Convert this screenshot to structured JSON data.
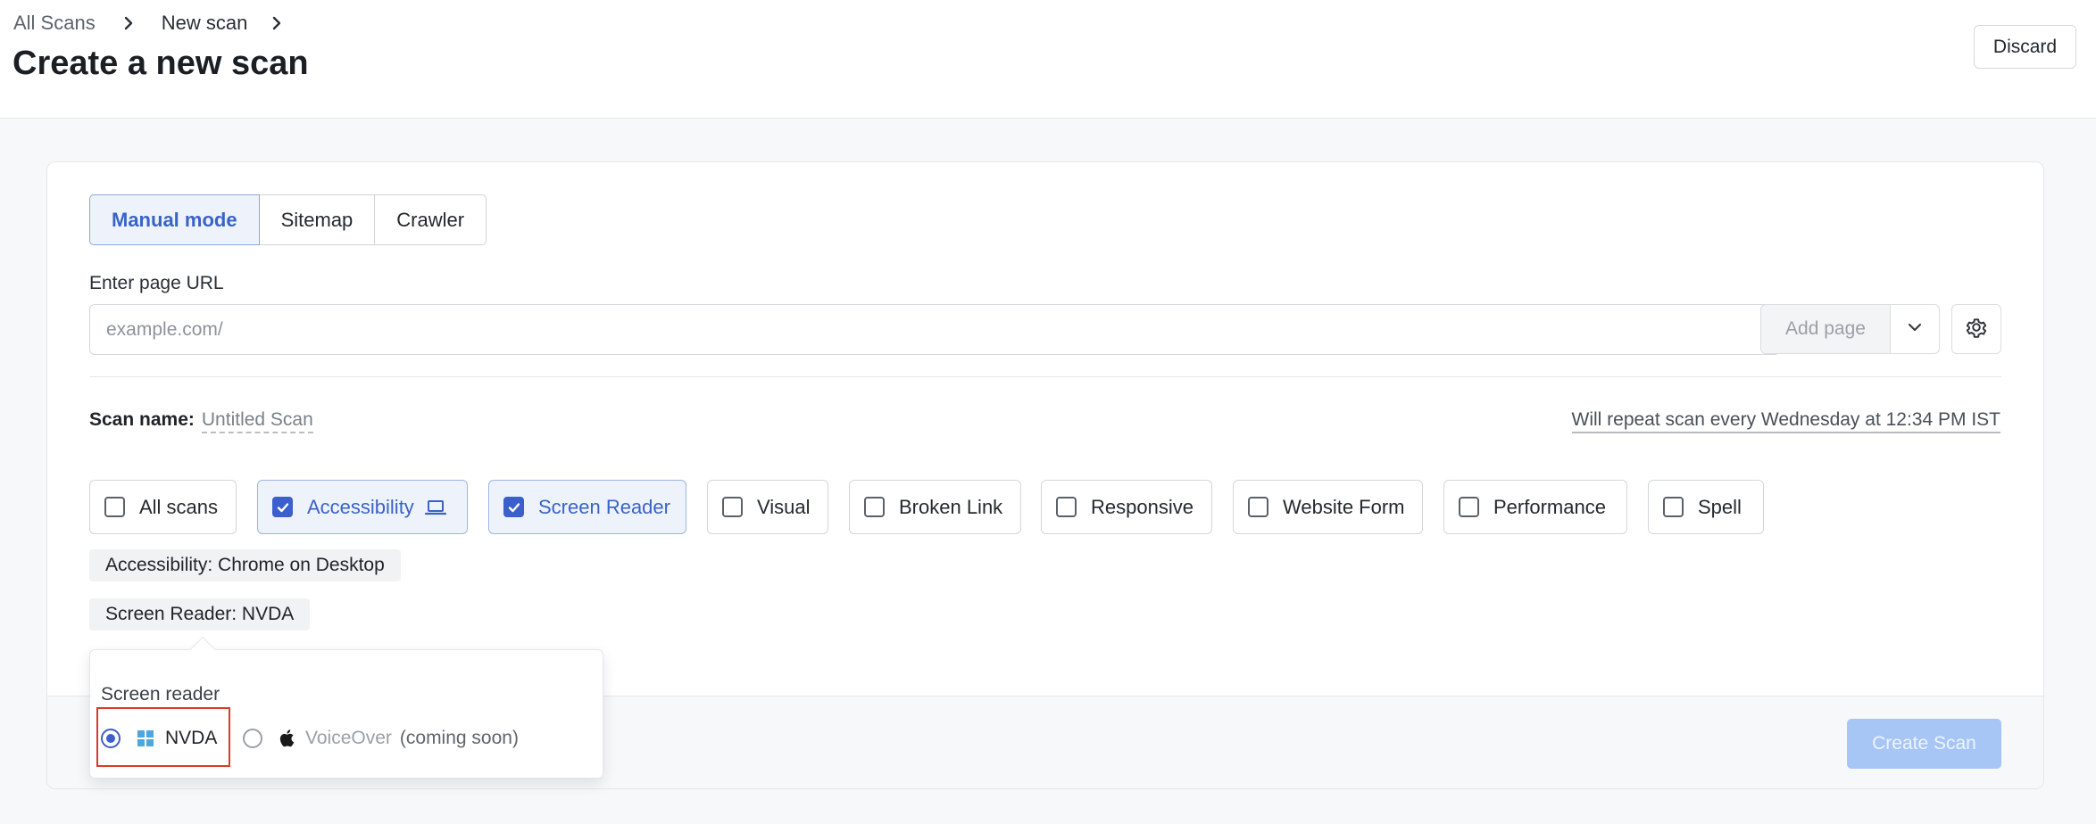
{
  "breadcrumb": {
    "root": "All Scans",
    "current": "New scan"
  },
  "page_title": "Create a new scan",
  "header": {
    "discard_label": "Discard"
  },
  "modes": {
    "tabs": [
      "Manual mode",
      "Sitemap",
      "Crawler"
    ],
    "active": "Manual mode"
  },
  "url_entry": {
    "label": "Enter page URL",
    "placeholder": "example.com/",
    "add_page_label": "Add page"
  },
  "scan_name": {
    "label": "Scan name:",
    "value": "Untitled Scan"
  },
  "schedule": {
    "text": "Will repeat scan every Wednesday at 12:34 PM IST"
  },
  "scan_types": [
    {
      "label": "All scans",
      "checked": false
    },
    {
      "label": "Accessibility",
      "checked": true,
      "icon": "laptop-icon"
    },
    {
      "label": "Screen Reader",
      "checked": true
    },
    {
      "label": "Visual",
      "checked": false
    },
    {
      "label": "Broken Link",
      "checked": false
    },
    {
      "label": "Responsive",
      "checked": false
    },
    {
      "label": "Website Form",
      "checked": false
    },
    {
      "label": "Performance",
      "checked": false
    },
    {
      "label": "Spell",
      "checked": false
    }
  ],
  "config_tags": {
    "accessibility": "Accessibility: Chrome on Desktop",
    "screen_reader": "Screen Reader: NVDA"
  },
  "popover": {
    "title": "Screen reader",
    "options": [
      {
        "label": "NVDA",
        "selected": true,
        "icon": "windows-icon"
      },
      {
        "label": "VoiceOver",
        "note": "(coming soon)",
        "selected": false,
        "disabled": true,
        "icon": "apple-icon"
      }
    ]
  },
  "footer": {
    "create_label": "Create Scan"
  },
  "colors": {
    "accent": "#3b5fcb",
    "highlight": "#d93b2b",
    "windows_blue": "#4aa8df"
  }
}
